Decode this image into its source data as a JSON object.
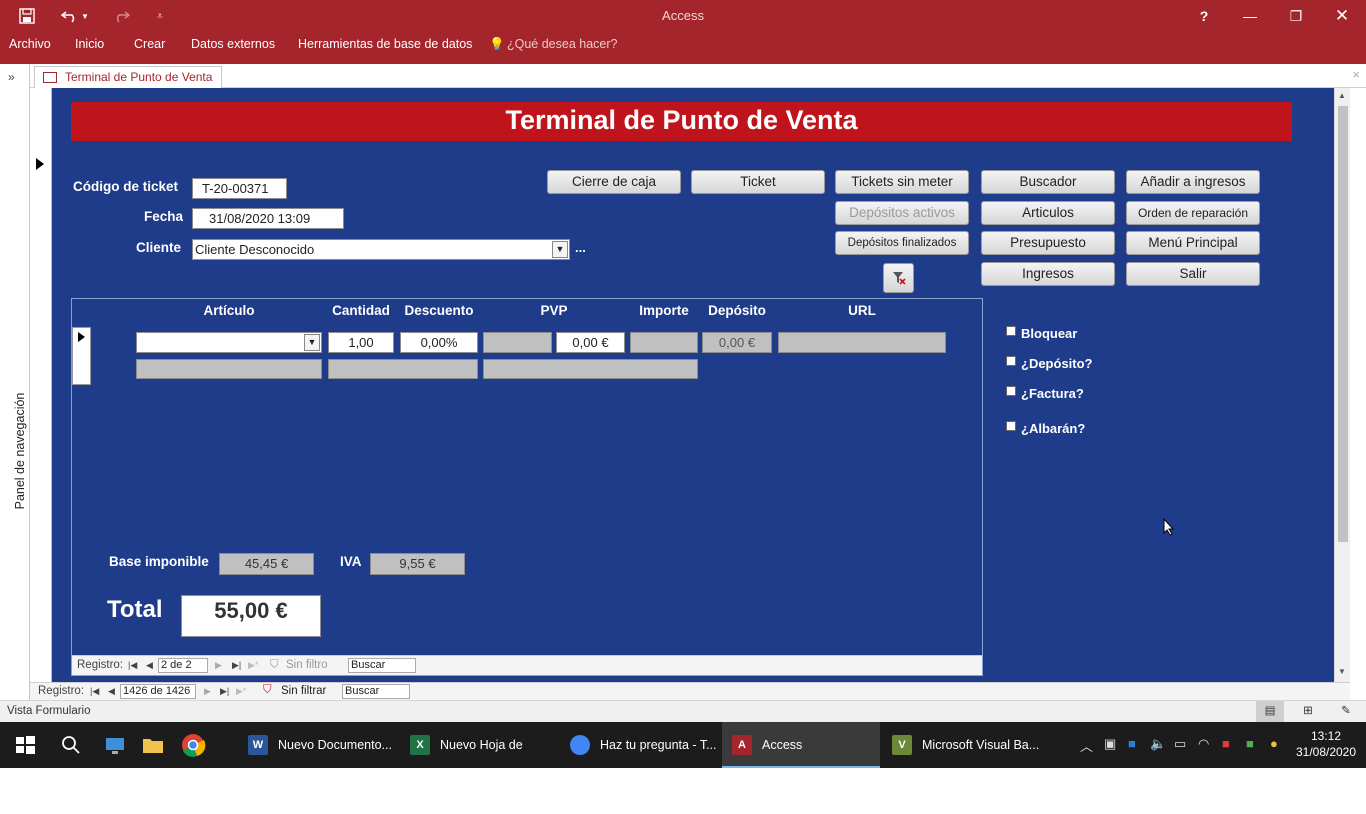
{
  "window": {
    "title": "Access",
    "help": "?"
  },
  "ribbon": {
    "menu": [
      "Archivo",
      "Inicio",
      "Crear",
      "Datos externos",
      "Herramientas de base de datos"
    ],
    "tell_me": "¿Qué desea hacer?"
  },
  "nav_pane": {
    "label": "Panel de navegación",
    "toggle": "»"
  },
  "doc_tab": {
    "label": "Terminal de Punto de Venta",
    "close": "×"
  },
  "form": {
    "banner": "Terminal de Punto de Venta",
    "fields": {
      "ticket_label": "Código de ticket",
      "ticket_value": "T-20-00371",
      "date_label": "Fecha",
      "date_value": "31/08/2020 13:09",
      "client_label": "Cliente",
      "client_value": "Cliente Desconocido",
      "client_more": "..."
    },
    "buttons": {
      "cierre": "Cierre de caja",
      "ticket": "Ticket",
      "tickets_sin_meter": "Tickets sin meter",
      "buscador": "Buscador",
      "anadir_ingresos": "Añadir a ingresos",
      "depositos_activos": "Depósitos activos",
      "articulos": "Articulos",
      "orden_reparacion": "Orden de reparación",
      "depositos_finalizados": "Depósitos finalizados",
      "presupuesto": "Presupuesto",
      "menu_principal": "Menú Principal",
      "ingresos": "Ingresos",
      "salir": "Salir"
    },
    "subform": {
      "headers": [
        "Artículo",
        "Cantidad",
        "Descuento",
        "PVP",
        "Importe",
        "Depósito",
        "URL"
      ],
      "row": {
        "articulo": "",
        "cantidad": "1,00",
        "descuento": "0,00%",
        "pvp": "",
        "importe": "0,00 €",
        "importe2": "",
        "deposito": "0,00 €",
        "url": ""
      },
      "nav": {
        "label": "Registro:",
        "position": "2 de 2",
        "filter": "Sin filtro",
        "search": "Buscar"
      }
    },
    "totals": {
      "base_label": "Base imponible",
      "base_value": "45,45 €",
      "iva_label": "IVA",
      "iva_value": "9,55 €",
      "total_label": "Total",
      "total_value": "55,00 €"
    },
    "checkboxes": [
      "Bloquear",
      "¿Depósito?",
      "¿Factura?",
      "¿Albarán?"
    ]
  },
  "main_nav": {
    "label": "Registro:",
    "position": "1426 de 1426",
    "filter": "Sin filtrar",
    "search": "Buscar"
  },
  "status_bar": {
    "text": "Vista Formulario"
  },
  "taskbar": {
    "apps": [
      "Nuevo Documento...",
      "Nuevo Hoja de cálc...",
      "Haz tu pregunta - T...",
      "Access",
      "Microsoft Visual Ba..."
    ],
    "time": "13:12",
    "date": "31/08/2020"
  },
  "colors": {
    "brand": "#a4262c",
    "form_bg": "#1f3c8a",
    "banner": "#c0141c"
  }
}
